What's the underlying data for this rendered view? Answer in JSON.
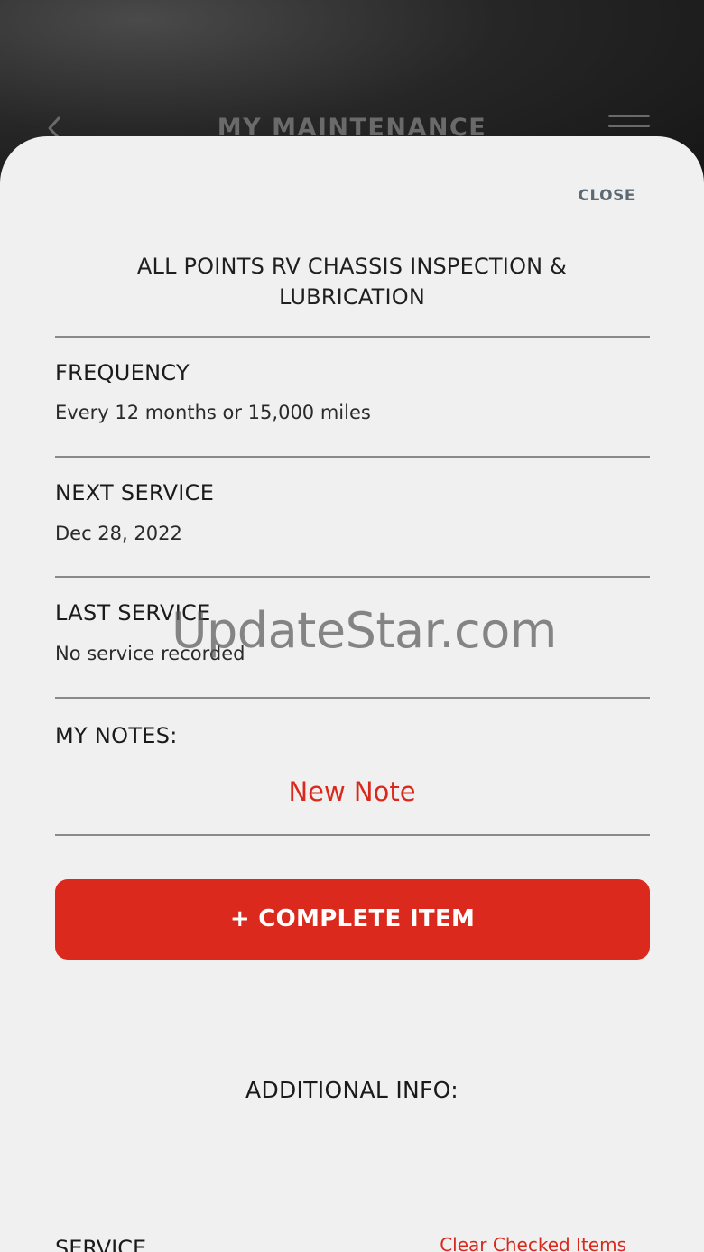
{
  "header": {
    "title": "MY MAINTENANCE",
    "back_icon": "chevron-left-icon",
    "menu_icon": "hamburger-menu-icon"
  },
  "sheet": {
    "close_label": "CLOSE",
    "item_title": "ALL POINTS RV CHASSIS INSPECTION & LUBRICATION",
    "sections": [
      {
        "label": "FREQUENCY",
        "value": "Every 12 months or 15,000 miles"
      },
      {
        "label": "NEXT SERVICE",
        "value": "Dec 28, 2022"
      },
      {
        "label": "LAST SERVICE",
        "value": "No service recorded"
      }
    ],
    "notes_label": "MY NOTES:",
    "new_note_label": "New Note",
    "complete_button_label": "+ COMPLETE ITEM",
    "additional_info_label": "ADDITIONAL INFO:",
    "service_label": "SERVICE",
    "clear_checked_label": "Clear Checked Items"
  },
  "watermark": "UpdateStar.com",
  "colors": {
    "accent_red": "#dc291d",
    "sheet_background": "#f0f0f0",
    "header_background": "#1a1a1a",
    "close_text": "#5d6a73"
  }
}
